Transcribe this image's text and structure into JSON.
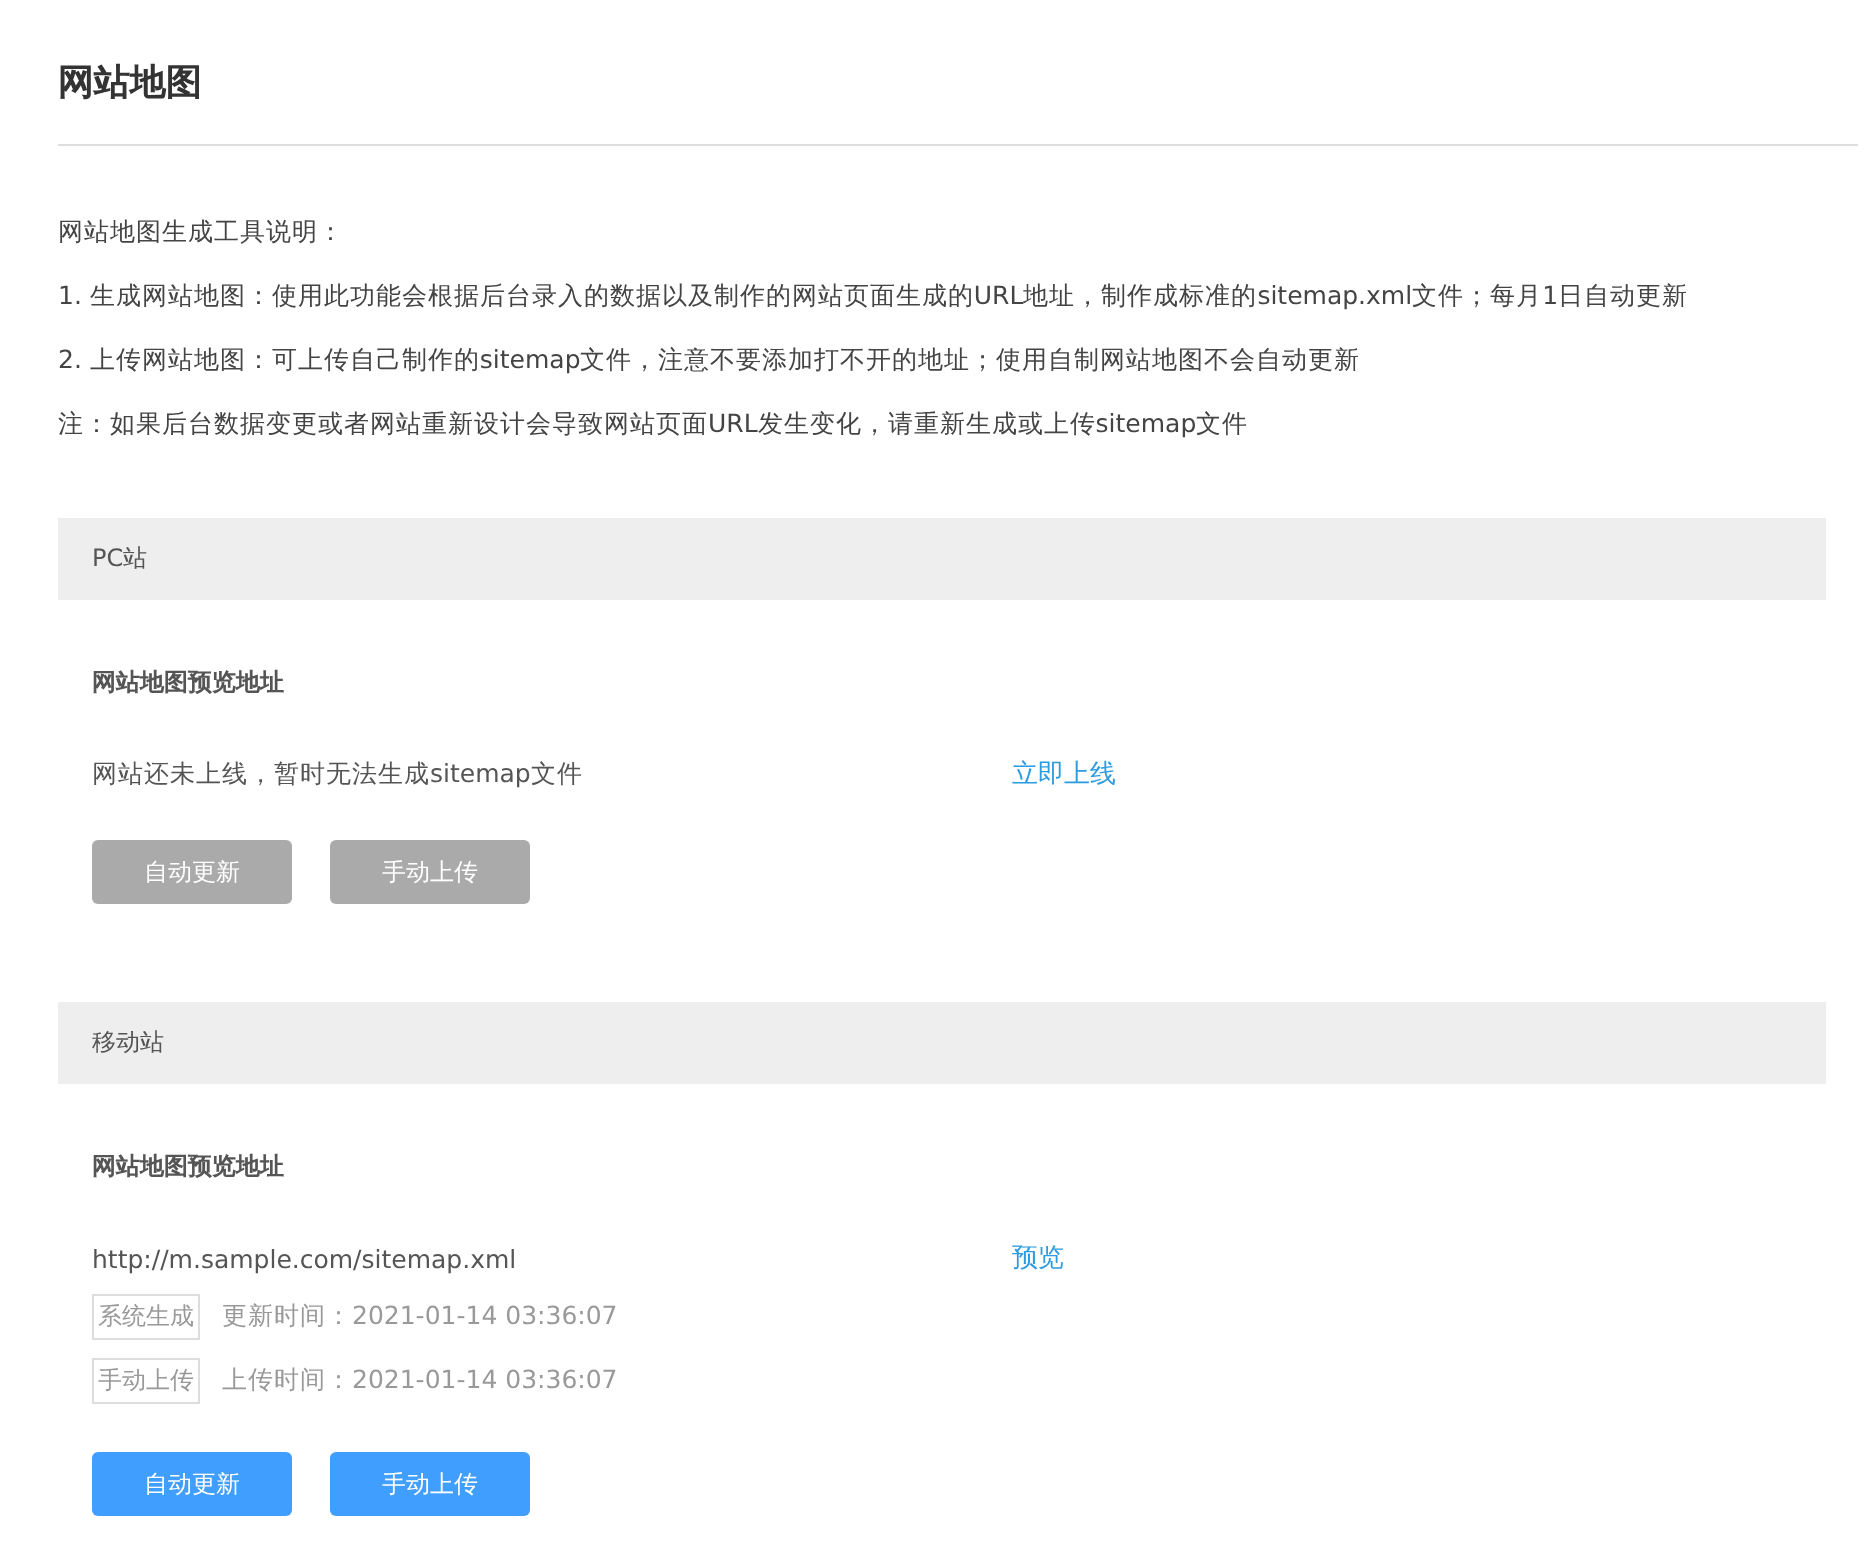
{
  "page_title": "网站地图",
  "intro": [
    "网站地图生成工具说明：",
    "1. 生成网站地图：使用此功能会根据后台录入的数据以及制作的网站页面生成的URL地址，制作成标准的sitemap.xml文件；每月1日自动更新",
    "2. 上传网站地图：可上传自己制作的sitemap文件，注意不要添加打不开的地址；使用自制网站地图不会自动更新",
    "注：如果后台数据变更或者网站重新设计会导致网站页面URL发生变化，请重新生成或上传sitemap文件"
  ],
  "sections": [
    {
      "title": "PC站",
      "subtitle": "网站地图预览地址",
      "address": "网站还未上线，暂时无法生成sitemap文件",
      "link": "立即上线",
      "buttons": [
        {
          "label": "自动更新",
          "disabled": true
        },
        {
          "label": "手动上传",
          "disabled": true
        }
      ]
    },
    {
      "title": "移动站",
      "subtitle": "网站地图预览地址",
      "address": "http://m.sample.com/sitemap.xml",
      "link": "预览",
      "records": [
        {
          "tag": "系统生成",
          "text": "更新时间：2021-01-14 03:36:07"
        },
        {
          "tag": "手动上传",
          "text": "上传时间：2021-01-14 03:36:07"
        }
      ],
      "buttons": [
        {
          "label": "自动更新",
          "disabled": false
        },
        {
          "label": "手动上传",
          "disabled": false
        }
      ]
    }
  ]
}
